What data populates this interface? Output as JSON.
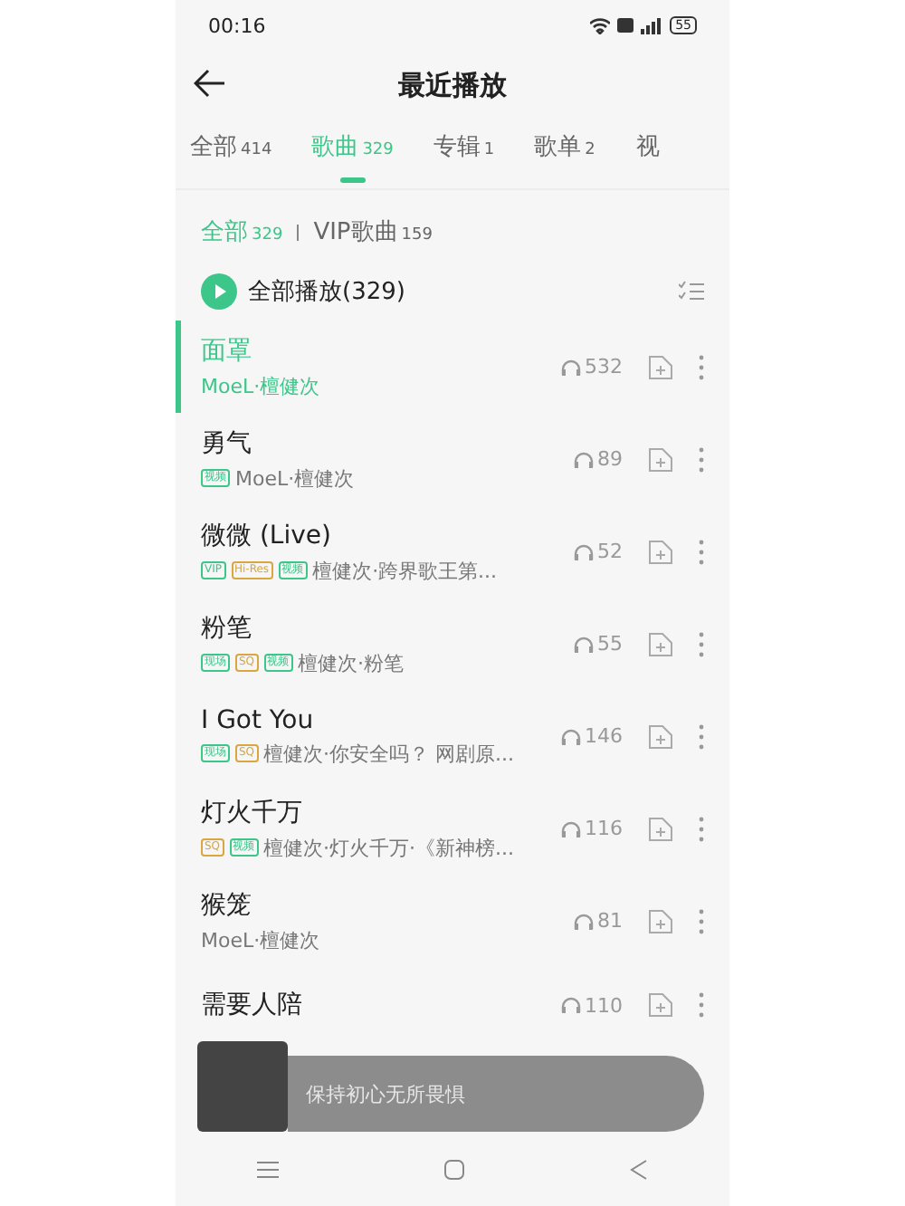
{
  "status_bar": {
    "time": "00:16",
    "battery": "55"
  },
  "header": {
    "title": "最近播放"
  },
  "tabs": [
    {
      "label": "全部",
      "count": "414",
      "selected": false
    },
    {
      "label": "歌曲",
      "count": "329",
      "selected": true
    },
    {
      "label": "专辑",
      "count": "1",
      "selected": false
    },
    {
      "label": "歌单",
      "count": "2",
      "selected": false
    },
    {
      "label": "视",
      "selected": false
    }
  ],
  "filters": [
    {
      "label": "全部",
      "count": "329",
      "selected": true
    },
    {
      "label": "VIP歌曲",
      "count": "159",
      "selected": false
    }
  ],
  "play_all": {
    "label": "全部播放(329)"
  },
  "songs": [
    {
      "title": "面罩",
      "subtitle": "MoeL·檀健次",
      "plays": "532",
      "selected": true
    },
    {
      "title": "勇气",
      "subtitle": "MoeL·檀健次",
      "plays": "89",
      "selected": false,
      "tags": [
        {
          "label": "视频",
          "kind": "green"
        }
      ]
    },
    {
      "title": "微微 (Live)",
      "subtitle": "檀健次·跨界歌王第...",
      "plays": "52",
      "selected": false,
      "tags": [
        {
          "label": "VIP",
          "kind": "green"
        },
        {
          "label": "Hi-Res",
          "kind": "gold"
        },
        {
          "label": "视频",
          "kind": "green"
        }
      ]
    },
    {
      "title": "粉笔",
      "subtitle": "檀健次·粉笔",
      "plays": "55",
      "selected": false,
      "tags": [
        {
          "label": "现场",
          "kind": "green"
        },
        {
          "label": "SQ",
          "kind": "gold"
        },
        {
          "label": "视频",
          "kind": "green"
        }
      ]
    },
    {
      "title": "I Got You",
      "subtitle": "檀健次·你安全吗？ 网剧原...",
      "plays": "146",
      "selected": false,
      "tags": [
        {
          "label": "现场",
          "kind": "green"
        },
        {
          "label": "SQ",
          "kind": "gold"
        }
      ]
    },
    {
      "title": "灯火千万",
      "subtitle": "檀健次·灯火千万·《新神榜...",
      "plays": "116",
      "selected": false,
      "tags": [
        {
          "label": "SQ",
          "kind": "gold"
        },
        {
          "label": "视频",
          "kind": "green"
        }
      ]
    },
    {
      "title": "猴笼",
      "subtitle": "MoeL·檀健次",
      "plays": "81",
      "selected": false
    },
    {
      "title": "需要人陪",
      "plays": "110",
      "selected": false
    }
  ],
  "mini_player": {
    "song": "保持初心无所畏惧"
  }
}
